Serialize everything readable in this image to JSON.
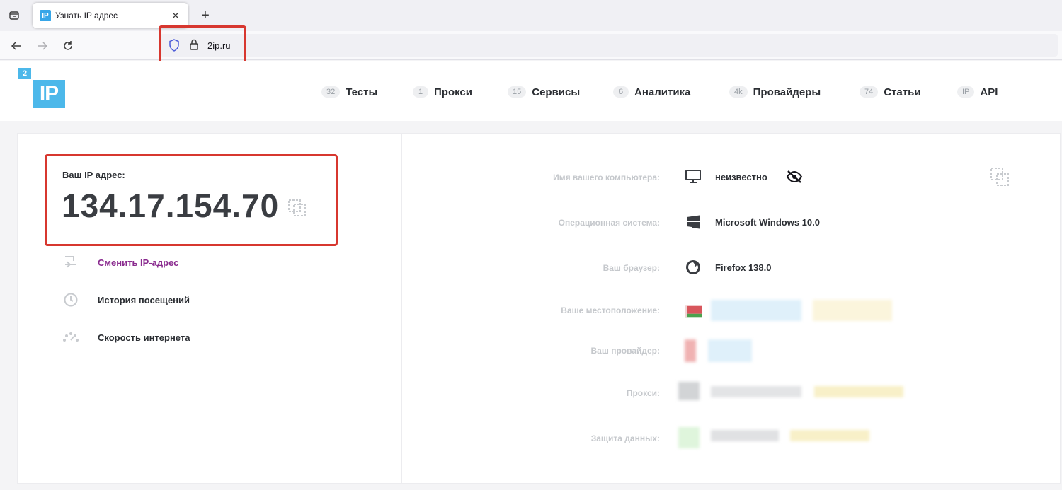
{
  "browser": {
    "tab_title": "Узнать IP адрес",
    "tab_favicon": "IP",
    "url": "2ip.ru"
  },
  "site": {
    "logo_small": "2",
    "logo_big": "IP",
    "menu": [
      {
        "badge": "32",
        "label": "Тесты"
      },
      {
        "badge": "1",
        "label": "Прокси"
      },
      {
        "badge": "15",
        "label": "Сервисы"
      },
      {
        "badge": "6",
        "label": "Аналитика"
      },
      {
        "badge": "4k",
        "label": "Провайдеры"
      },
      {
        "badge": "74",
        "label": "Статьи"
      },
      {
        "badge": "IP",
        "label": "API"
      }
    ]
  },
  "ip": {
    "label": "Ваш IP адрес:",
    "value": "134.17.154.70"
  },
  "side_links": [
    {
      "label": "Сменить IP-адрес",
      "icon": "swap-icon"
    },
    {
      "label": "История посещений",
      "icon": "history-icon"
    },
    {
      "label": "Скорость интернета",
      "icon": "speedometer-icon"
    }
  ],
  "info": {
    "computer_label": "Имя вашего компьютера:",
    "computer_value": "неизвестно",
    "os_label": "Операционная система:",
    "os_value": "Microsoft Windows 10.0",
    "browser_label": "Ваш браузер:",
    "browser_value": "Firefox 138.0",
    "location_label": "Ваше местоположение:",
    "provider_label": "Ваш провайдер:",
    "proxy_label": "Прокси:",
    "protection_label": "Защита данных:"
  },
  "colors": {
    "accent": "#4cb8ea",
    "highlight": "#d7372f",
    "link": "#8a2b8f"
  }
}
